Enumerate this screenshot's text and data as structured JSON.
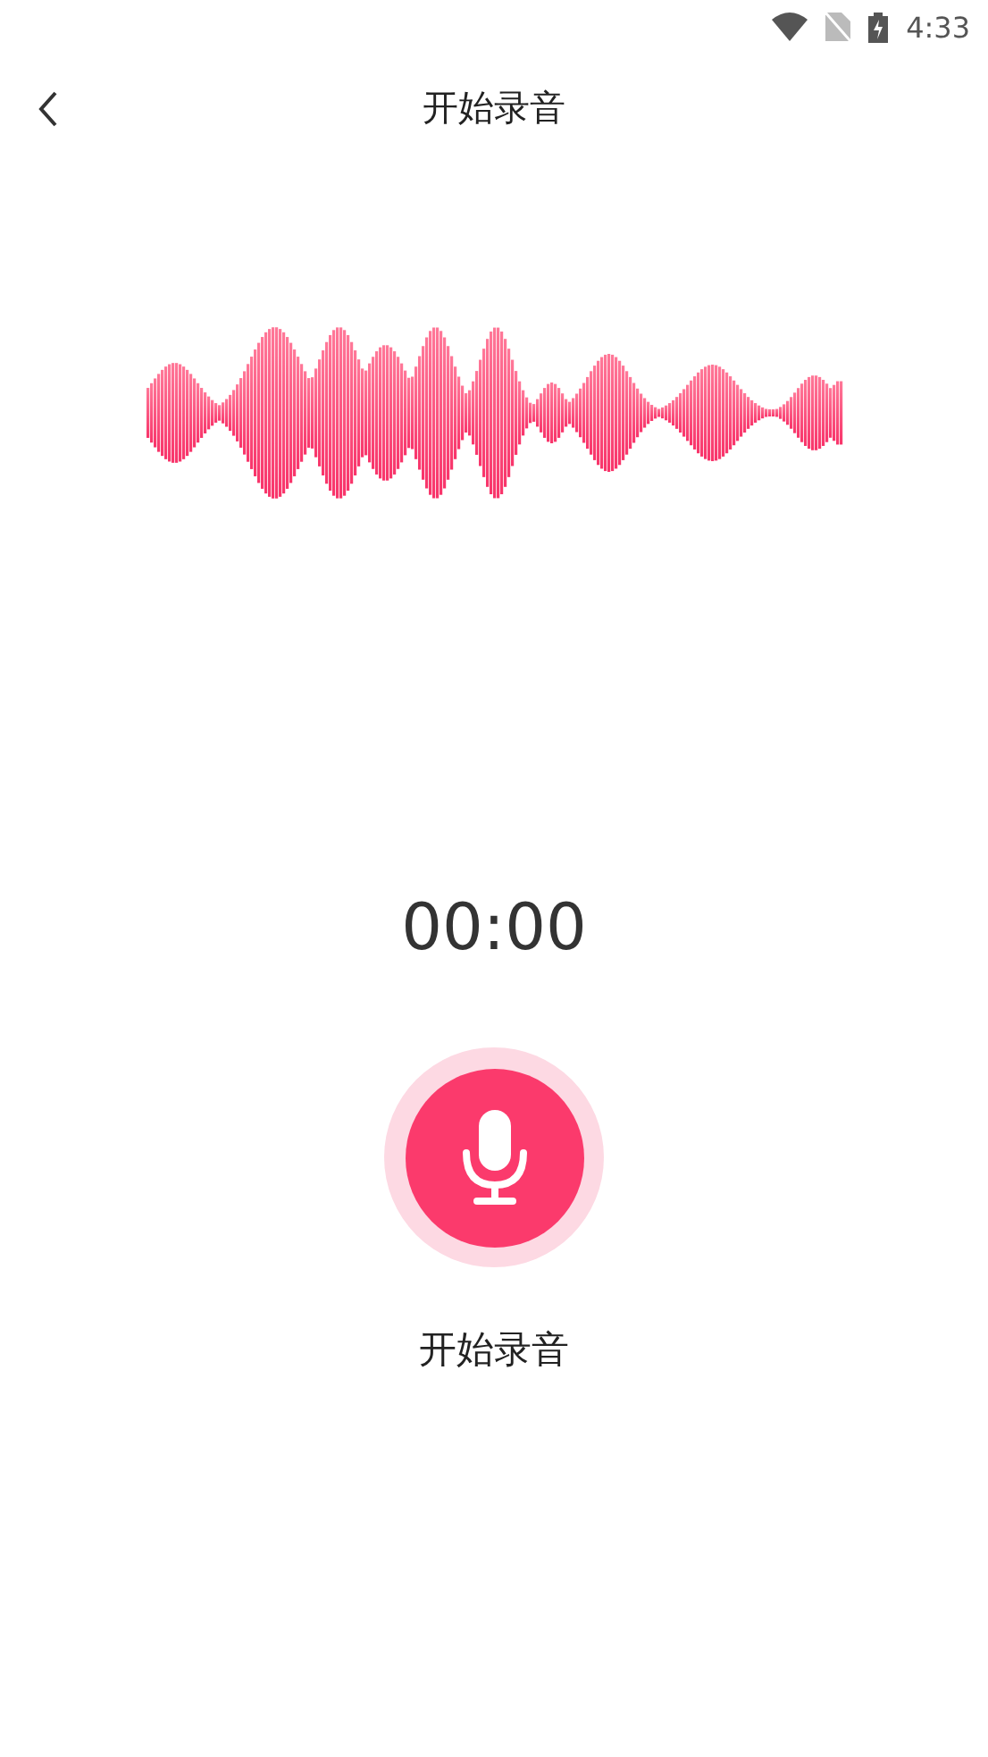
{
  "status_bar": {
    "time": "4:33"
  },
  "header": {
    "title": "开始录音"
  },
  "timer": "00:00",
  "record_button": {
    "label": "开始录音"
  }
}
